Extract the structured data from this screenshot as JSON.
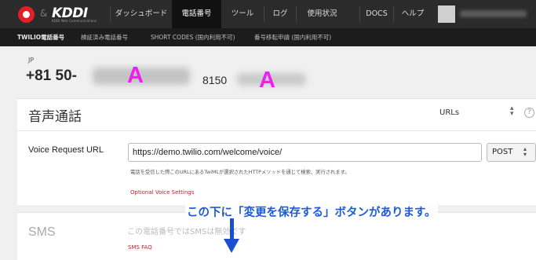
{
  "brand": {
    "amp": "&",
    "kddi": "KDDI",
    "kddi_sub": "KDDI Web Communications"
  },
  "nav": {
    "items": [
      "ダッシュボード",
      "電話番号",
      "ツール",
      "ログ",
      "使用状況",
      "DOCS",
      "ヘルプ"
    ],
    "active": "電話番号"
  },
  "subnav": {
    "items": [
      "TWILIO電話番号",
      "検証済み電話番号",
      "SHORT CODES (国内利用不可)",
      "番号移転申請 (国内利用不可)"
    ]
  },
  "number": {
    "country": "JP",
    "phone": "+81 50-",
    "friendly_name": "8150",
    "marker": "A"
  },
  "voice": {
    "title": "音声通話",
    "config_mode": "URLs",
    "help": "?",
    "request_url_label": "Voice Request URL",
    "request_url_value": "https://demo.twilio.com/welcome/voice/",
    "method": "POST",
    "help_text": "電話を受信した際このURLにあるTwiMLが選択されたHTTPメソッドを通じて検索、実行されます。",
    "optional_link": "Optional Voice Settings"
  },
  "sms": {
    "title": "SMS",
    "disabled_text": "この電話番号ではSMSは無効です",
    "faq_link": "SMS FAQ"
  },
  "annotation": {
    "text": "この下に「変更を保存する」ボタンがあります。"
  },
  "colors": {
    "marker": "#f01ef0",
    "annotation": "#1e5bd6",
    "link": "#b02a2a"
  }
}
